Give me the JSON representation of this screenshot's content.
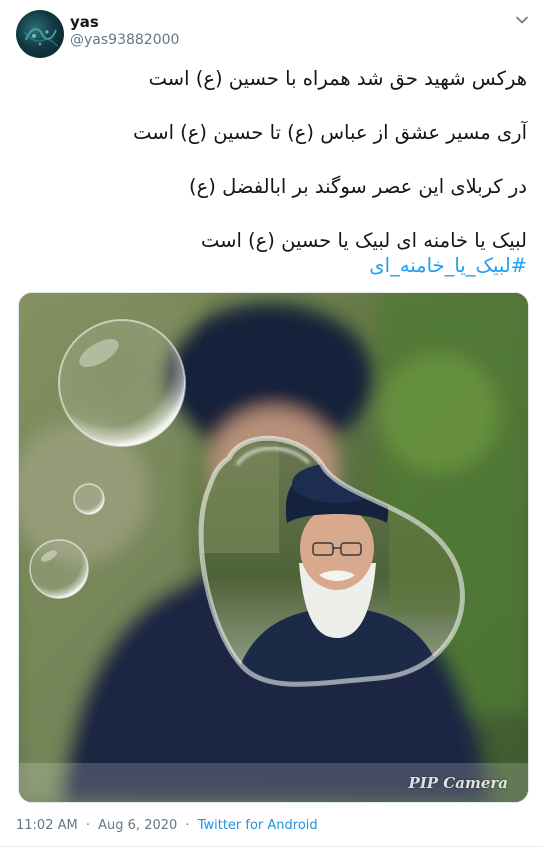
{
  "user": {
    "name": "yas",
    "handle": "@yas93882000"
  },
  "tweet": {
    "lines": [
      "هرکس شهید حق شد همراه با حسین (ع) است",
      "آری مسیر عشق از عباس (ع)  تا حسین (ع) است",
      "در کربلای این عصر سوگند بر ابالفضل (ع)",
      "لبیک یا خامنه ای لبیک یا حسین (ع) است"
    ],
    "hashtag": "#لبیک_یا_خامنه_ای"
  },
  "media": {
    "watermark": "PIP Camera"
  },
  "meta": {
    "time": "11:02 AM",
    "separator": "·",
    "date": "Aug 6, 2020",
    "source": "Twitter for Android"
  },
  "icons": {
    "more": "chevron-down-icon"
  },
  "colors": {
    "link": "#1da1f2",
    "source_link": "#1b95e0",
    "secondary_text": "#657786"
  }
}
